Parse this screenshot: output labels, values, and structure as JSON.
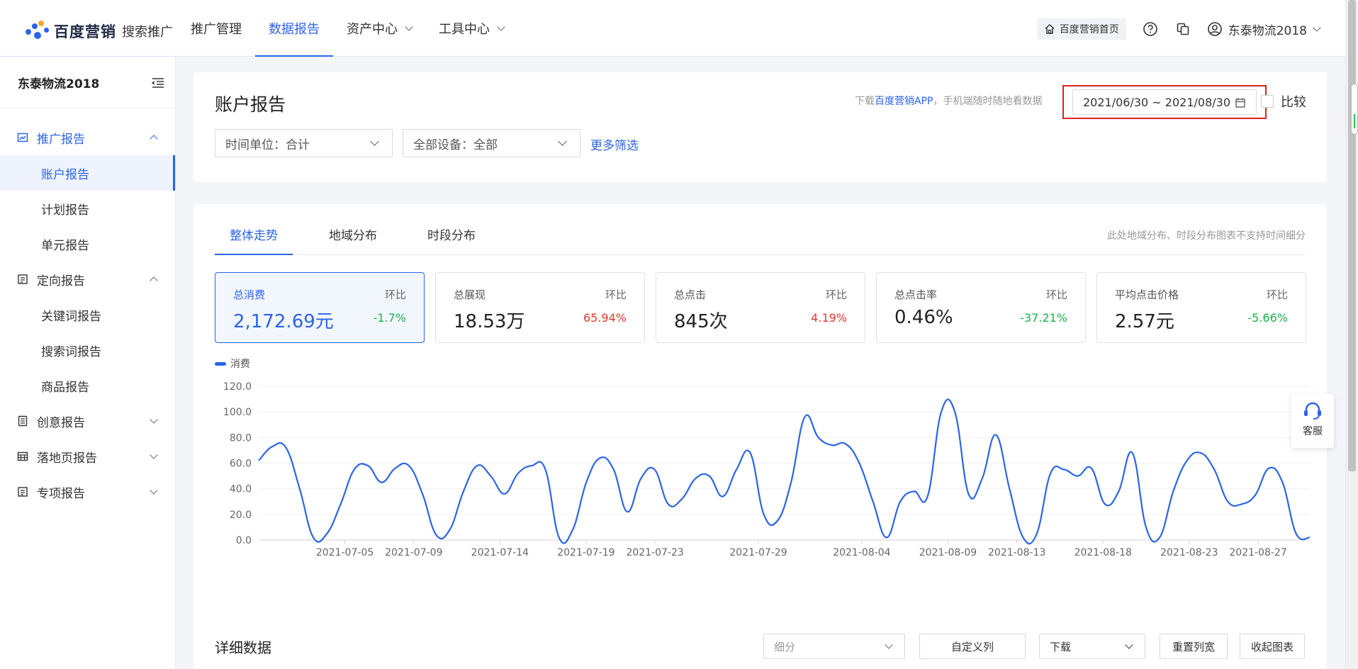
{
  "brand": {
    "name": "百度营销",
    "product": "搜索推广"
  },
  "topnav": [
    {
      "label": "推广管理",
      "active": false,
      "dropdown": false
    },
    {
      "label": "数据报告",
      "active": true,
      "dropdown": false
    },
    {
      "label": "资产中心",
      "active": false,
      "dropdown": true
    },
    {
      "label": "工具中心",
      "active": false,
      "dropdown": true
    }
  ],
  "topright": {
    "home_label": "百度营销首页",
    "user_name": "东泰物流2018"
  },
  "sidebar": {
    "account": "东泰物流2018",
    "groups": [
      {
        "label": "推广报告",
        "icon": "chart-icon",
        "expanded": true,
        "active": true,
        "items": [
          {
            "label": "账户报告",
            "active": true
          },
          {
            "label": "计划报告"
          },
          {
            "label": "单元报告"
          }
        ]
      },
      {
        "label": "定向报告",
        "icon": "target-icon",
        "expanded": true,
        "items": [
          {
            "label": "关键词报告"
          },
          {
            "label": "搜索词报告"
          },
          {
            "label": "商品报告"
          }
        ]
      },
      {
        "label": "创意报告",
        "icon": "creative-icon",
        "expanded": false,
        "items": []
      },
      {
        "label": "落地页报告",
        "icon": "landing-page-icon",
        "expanded": false,
        "items": []
      },
      {
        "label": "专项报告",
        "icon": "special-icon",
        "expanded": false,
        "items": []
      }
    ]
  },
  "filter": {
    "page_title": "账户报告",
    "app_tip_prefix": "下载",
    "app_tip_link": "百度营销APP",
    "app_tip_suffix": "，手机端随时随地看数据",
    "date_range": "2021/06/30 ~ 2021/08/30",
    "compare_label": "比较",
    "time_unit": "时间单位：合计",
    "device": "全部设备：全部",
    "more_filter": "更多筛选"
  },
  "tabs": [
    {
      "label": "整体走势",
      "active": true
    },
    {
      "label": "地域分布",
      "active": false
    },
    {
      "label": "时段分布",
      "active": false
    }
  ],
  "tab_note": "此处地域分布、时段分布图表不支持时间细分",
  "metrics": [
    {
      "label": "总消费",
      "hb_label": "环比",
      "value": "2,172.69元",
      "change": "-1.7%",
      "trend": "down",
      "active": true
    },
    {
      "label": "总展现",
      "hb_label": "环比",
      "value": "18.53万",
      "change": "65.94%",
      "trend": "up"
    },
    {
      "label": "总点击",
      "hb_label": "环比",
      "value": "845次",
      "change": "4.19%",
      "trend": "up"
    },
    {
      "label": "总点击率",
      "hb_label": "环比",
      "value": "0.46%",
      "change": "-37.21%",
      "trend": "down"
    },
    {
      "label": "平均点击价格",
      "hb_label": "环比",
      "value": "2.57元",
      "change": "-5.66%",
      "trend": "down"
    }
  ],
  "colors": {
    "accent": "#2c64e8",
    "up": "#e5392d",
    "down": "#18b34a",
    "highlight": "#e02020"
  },
  "chart_data": {
    "type": "line",
    "legend": "消费",
    "ylim": [
      0,
      120
    ],
    "yticks": [
      "0.0",
      "20.0",
      "40.0",
      "60.0",
      "80.0",
      "100.0",
      "120.0"
    ],
    "xtick_labels": [
      "2021-07-05",
      "2021-07-09",
      "2021-07-14",
      "2021-07-19",
      "2021-07-23",
      "2021-07-29",
      "2021-08-04",
      "2021-08-09",
      "2021-08-13",
      "2021-08-18",
      "2021-08-23",
      "2021-08-27"
    ],
    "x_start": "2021-06-30",
    "x_end": "2021-08-30",
    "series": [
      {
        "name": "消费",
        "values": [
          62,
          73,
          72,
          40,
          2,
          5,
          28,
          55,
          58,
          45,
          56,
          58,
          36,
          4,
          8,
          38,
          58,
          50,
          36,
          52,
          58,
          55,
          2,
          8,
          45,
          64,
          55,
          22,
          48,
          55,
          28,
          32,
          48,
          50,
          34,
          55,
          68,
          20,
          15,
          45,
          96,
          80,
          74,
          75,
          60,
          30,
          2,
          30,
          38,
          34,
          100,
          100,
          36,
          48,
          82,
          40,
          2,
          5,
          52,
          55,
          50,
          56,
          28,
          38,
          68,
          10,
          2,
          38,
          62,
          68,
          55,
          30,
          28,
          35,
          56,
          45,
          5,
          2
        ]
      }
    ]
  },
  "detail": {
    "title": "详细数据",
    "subdivide_placeholder": "细分",
    "custom_columns": "自定义列",
    "download": "下载",
    "reset_width": "重置列宽",
    "collapse_chart": "收起图表"
  },
  "service_label": "客服"
}
